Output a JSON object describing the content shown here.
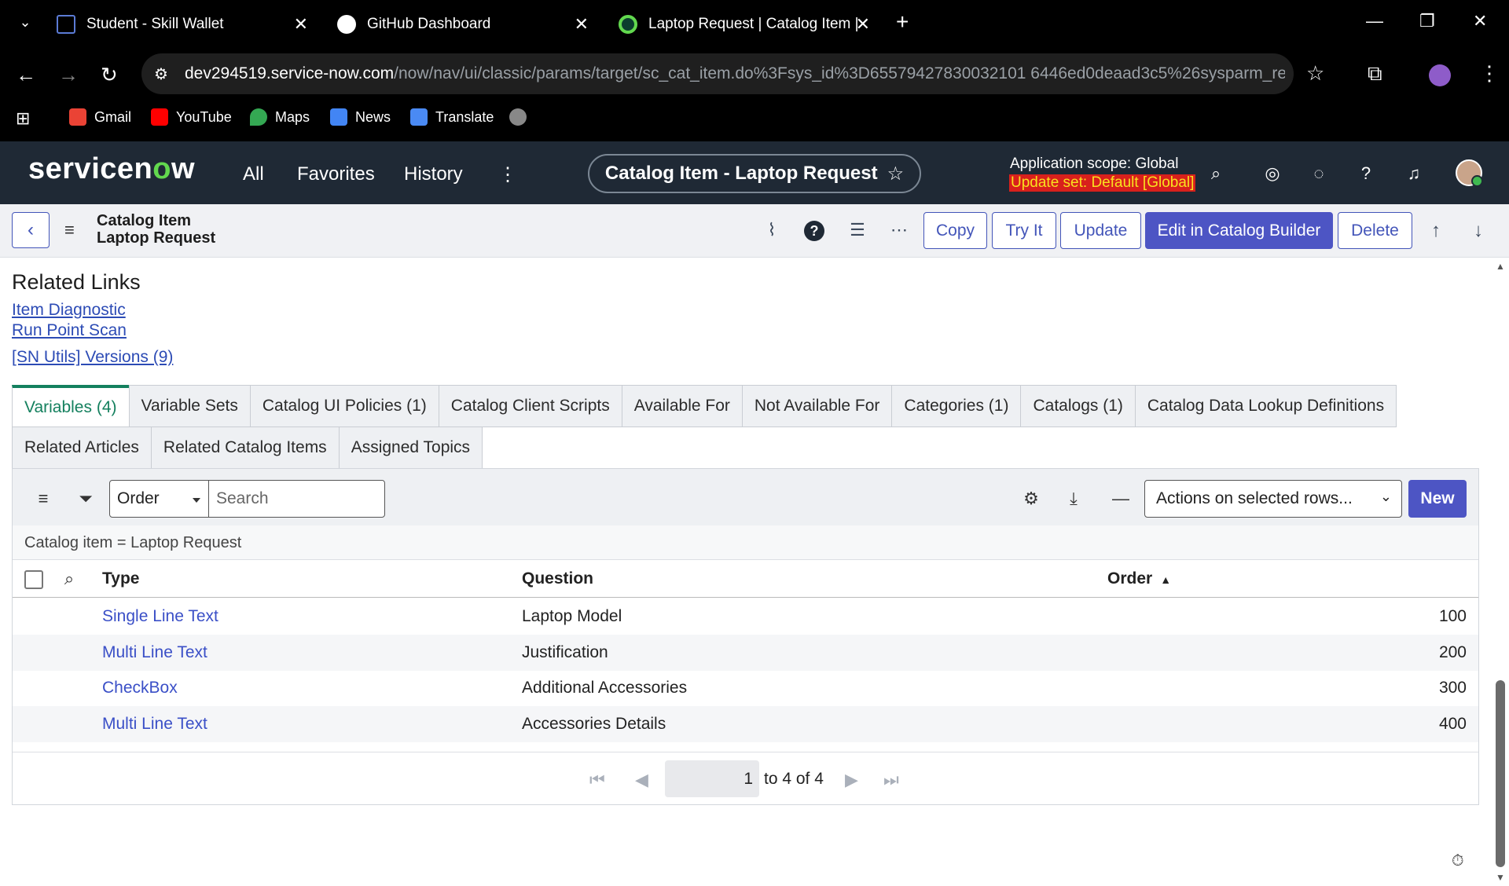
{
  "browser": {
    "tabs": [
      {
        "title": "Student - Skill Wallet"
      },
      {
        "title": "GitHub Dashboard"
      },
      {
        "title": "Laptop Request | Catalog Item |"
      }
    ],
    "url_host": "dev294519.service-now.com",
    "url_path": "/now/nav/ui/classic/params/target/sc_cat_item.do%3Fsys_id%3D65579427830032101 6446ed0deaad3c5%26sysparm_recor...",
    "bookmarks": [
      "Gmail",
      "YouTube",
      "Maps",
      "News",
      "Translate"
    ]
  },
  "header": {
    "logo": "servicen",
    "logo_o": "o",
    "logo_tail": "w",
    "nav": [
      "All",
      "Favorites",
      "History"
    ],
    "page_pill": "Catalog Item - Laptop Request",
    "scope": "Application scope: Global",
    "update_set": "Update set: Default [Global]"
  },
  "form": {
    "type": "Catalog Item",
    "name": "Laptop Request",
    "buttons": {
      "copy": "Copy",
      "try_it": "Try It",
      "update": "Update",
      "edit_builder": "Edit in Catalog Builder",
      "delete": "Delete"
    }
  },
  "related_links": {
    "title": "Related Links",
    "links": [
      "Item Diagnostic",
      "Run Point Scan",
      "[SN Utils] Versions (9)"
    ]
  },
  "related_tabs": {
    "row1": [
      "Variables (4)",
      "Variable Sets",
      "Catalog UI Policies (1)",
      "Catalog Client Scripts",
      "Available For",
      "Not Available For",
      "Categories (1)",
      "Catalogs (1)",
      "Catalog Data Lookup Definitions"
    ],
    "row2": [
      "Related Articles",
      "Related Catalog Items",
      "Assigned Topics"
    ]
  },
  "list": {
    "sort_field": "Order",
    "search_placeholder": "Search",
    "actions_label": "Actions on selected rows...",
    "new_label": "New",
    "filter_text": "Catalog item = Laptop Request",
    "columns": [
      "Type",
      "Question",
      "Order"
    ],
    "rows": [
      {
        "type": "Single Line Text",
        "question": "Laptop Model",
        "order": "100"
      },
      {
        "type": "Multi Line Text",
        "question": "Justification",
        "order": "200"
      },
      {
        "type": "CheckBox",
        "question": "Additional Accessories",
        "order": "300"
      },
      {
        "type": "Multi Line Text",
        "question": "Accessories Details",
        "order": "400"
      }
    ],
    "pager": {
      "current": "1",
      "range_text": "to 4 of 4"
    }
  },
  "colors": {
    "header_bg": "#1f2935",
    "accent": "#4d55c4",
    "active_tab": "#14805e",
    "link": "#3a4fc7"
  }
}
